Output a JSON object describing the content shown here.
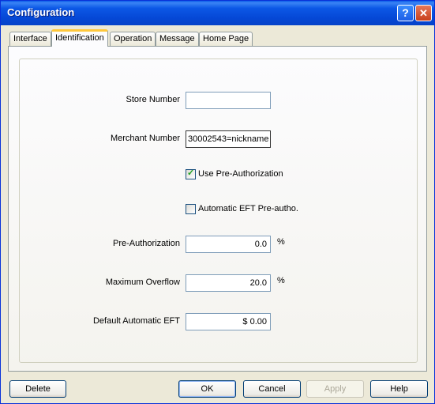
{
  "window": {
    "title": "Configuration",
    "help_glyph": "?",
    "close_glyph": "✕"
  },
  "tabs": [
    {
      "label": "Interface"
    },
    {
      "label": "Identification"
    },
    {
      "label": "Operation"
    },
    {
      "label": "Message"
    },
    {
      "label": "Home Page"
    }
  ],
  "active_tab": "Identification",
  "form": {
    "store_number": {
      "label": "Store Number",
      "value": ""
    },
    "merchant_number": {
      "label": "Merchant Number",
      "value": "30002543=nickname"
    },
    "use_preauth": {
      "label": "Use Pre-Authorization",
      "checked": true,
      "mark": "✓"
    },
    "auto_eft": {
      "label": "Automatic EFT Pre-autho.",
      "checked": false
    },
    "preauth": {
      "label": "Pre-Authorization",
      "value": "0.0",
      "unit": "%"
    },
    "max_overflow": {
      "label": "Maximum Overflow",
      "value": "20.0",
      "unit": "%"
    },
    "default_eft": {
      "label": "Default Automatic EFT",
      "value": "$ 0.00"
    }
  },
  "buttons": {
    "delete": "Delete",
    "ok": "OK",
    "cancel": "Cancel",
    "apply": "Apply",
    "help": "Help"
  },
  "colors": {
    "titlebar": "#0548d6",
    "active_tab_accent": "#ffc83c",
    "check_mark": "#21a121"
  }
}
